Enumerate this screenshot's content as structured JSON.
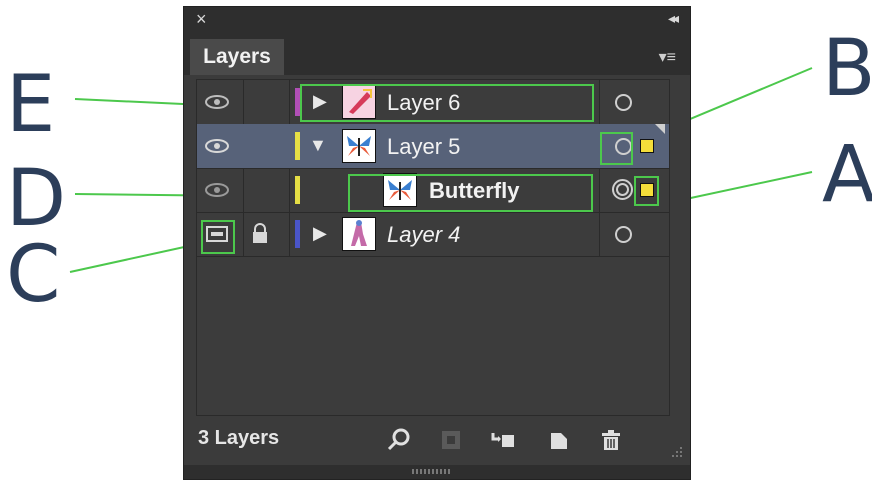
{
  "callouts": {
    "e": "E",
    "b": "B",
    "d": "D",
    "a": "A",
    "c": "C"
  },
  "panel": {
    "close_glyph": "×",
    "collapse_glyph": "◂◂",
    "tab_label": "Layers",
    "menu_glyph": "▾≡"
  },
  "layers": [
    {
      "name": "Layer 6",
      "expanded": false,
      "color": "#b14fb6",
      "selected": false,
      "italic": false,
      "locked": false,
      "visible": true
    },
    {
      "name": "Layer 5",
      "expanded": true,
      "color": "#e6df45",
      "selected": true,
      "italic": false,
      "locked": false,
      "visible": true
    },
    {
      "name": "Butterfly",
      "color": "#e6df45",
      "selected": false,
      "italic": false,
      "locked": false,
      "visible": true,
      "is_sublayer": true
    },
    {
      "name": "Layer 4",
      "expanded": false,
      "color": "#4a55c8",
      "selected": false,
      "italic": true,
      "locked": true,
      "visible": "template"
    }
  ],
  "footer": {
    "count_label": "3 Layers",
    "icons": [
      "search-icon",
      "clipping-mask-icon",
      "new-sublayer-icon",
      "new-layer-icon",
      "trash-icon"
    ]
  },
  "colors": {
    "highlight": "#4cc84c",
    "selection": "#f5de3a",
    "callout_text": "#2c3e5a"
  }
}
